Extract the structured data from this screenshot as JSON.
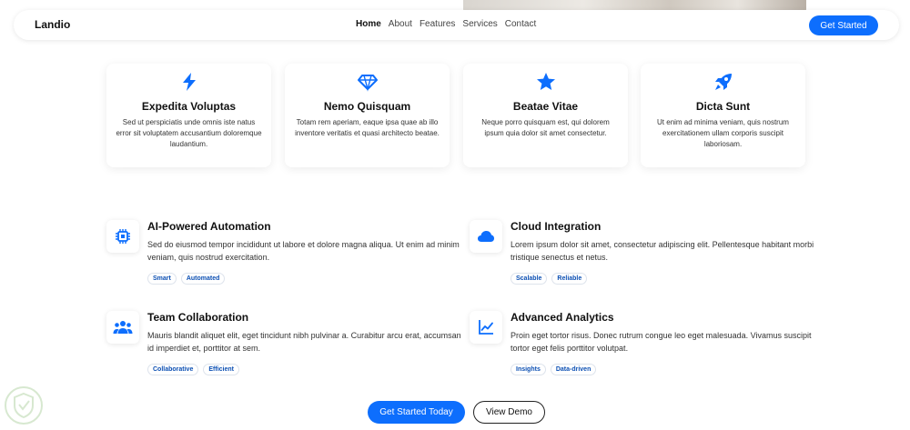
{
  "header": {
    "brand": "Landio",
    "nav": [
      {
        "label": "Home",
        "active": true
      },
      {
        "label": "About"
      },
      {
        "label": "Features"
      },
      {
        "label": "Services"
      },
      {
        "label": "Contact"
      }
    ],
    "cta_label": "Get Started"
  },
  "features": [
    {
      "icon": "lightning-icon",
      "title": "Expedita Voluptas",
      "text": "Sed ut perspiciatis unde omnis iste natus error sit voluptatem accusantium doloremque laudantium."
    },
    {
      "icon": "gem-icon",
      "title": "Nemo Quisquam",
      "text": "Totam rem aperiam, eaque ipsa quae ab illo inventore veritatis et quasi architecto beatae."
    },
    {
      "icon": "star-icon",
      "title": "Beatae Vitae",
      "text": "Neque porro quisquam est, qui dolorem ipsum quia dolor sit amet consectetur."
    },
    {
      "icon": "rocket-icon",
      "title": "Dicta Sunt",
      "text": "Ut enim ad minima veniam, quis nostrum exercitationem ullam corporis suscipit laboriosam."
    }
  ],
  "services": [
    {
      "icon": "cpu-icon",
      "title": "AI-Powered Automation",
      "text": "Sed do eiusmod tempor incididunt ut labore et dolore magna aliqua. Ut enim ad minim veniam, quis nostrud exercitation.",
      "tags": [
        "Smart",
        "Automated"
      ]
    },
    {
      "icon": "cloud-icon",
      "title": "Cloud Integration",
      "text": "Lorem ipsum dolor sit amet, consectetur adipiscing elit. Pellentesque habitant morbi tristique senectus et netus.",
      "tags": [
        "Scalable",
        "Reliable"
      ]
    },
    {
      "icon": "people-icon",
      "title": "Team Collaboration",
      "text": "Mauris blandit aliquet elit, eget tincidunt nibh pulvinar a. Curabitur arcu erat, accumsan id imperdiet et, porttitor at sem.",
      "tags": [
        "Collaborative",
        "Efficient"
      ]
    },
    {
      "icon": "chart-line-icon",
      "title": "Advanced Analytics",
      "text": "Proin eget tortor risus. Donec rutrum congue leo eget malesuada. Vivamus suscipit tortor eget felis porttitor volutpat.",
      "tags": [
        "Insights",
        "Data-driven"
      ]
    }
  ],
  "actions": {
    "primary": "Get Started Today",
    "secondary": "View Demo"
  },
  "colors": {
    "accent": "#0d6efd",
    "tag_text": "#0b4fb3"
  }
}
